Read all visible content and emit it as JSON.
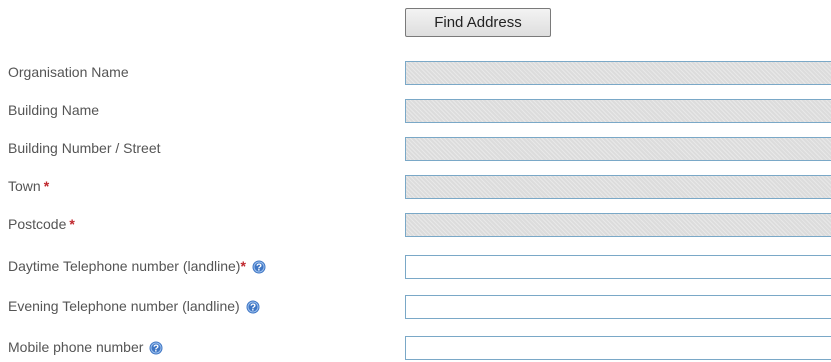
{
  "find_address_button": "Find Address",
  "fields": {
    "organisation_name": {
      "label": "Organisation Name",
      "value": ""
    },
    "building_name": {
      "label": "Building Name",
      "value": ""
    },
    "building_number_street": {
      "label": "Building Number / Street",
      "value": ""
    },
    "town": {
      "label": "Town",
      "required_marker": "*",
      "value": ""
    },
    "postcode": {
      "label": "Postcode",
      "required_marker": "*",
      "value": ""
    },
    "daytime_phone": {
      "label": "Daytime Telephone number (landline)",
      "required_marker": "*",
      "help_icon": "help-icon",
      "value": ""
    },
    "evening_phone": {
      "label": "Evening Telephone number (landline)",
      "help_icon": "help-icon",
      "value": ""
    },
    "mobile_phone": {
      "label": "Mobile phone number",
      "help_icon": "help-icon",
      "value": ""
    }
  },
  "colors": {
    "required_marker": "#c0272d",
    "field_border": "#7aa8c7",
    "disabled_field_bg": "#dcdcdc",
    "help_icon": "#3f76c4",
    "label_text": "#555555"
  }
}
